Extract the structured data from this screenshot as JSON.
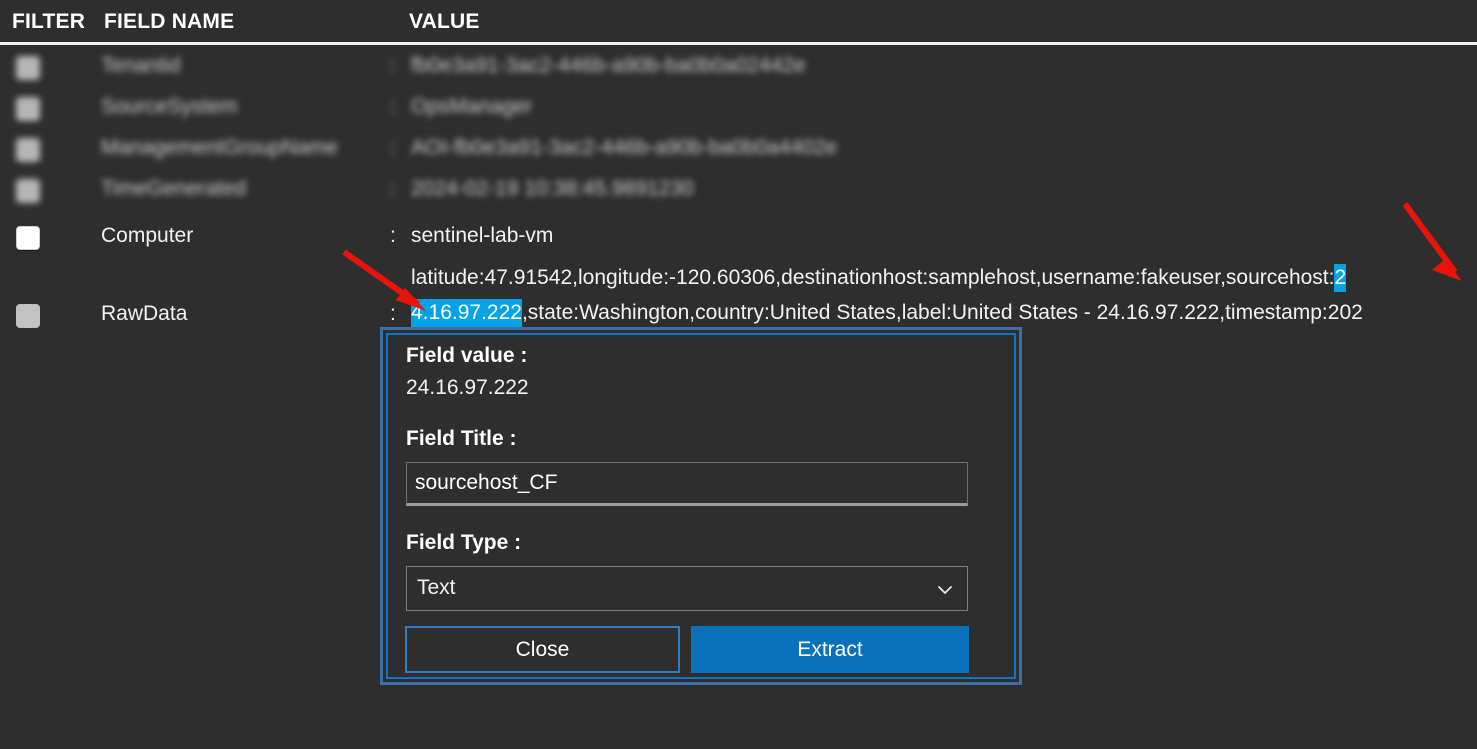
{
  "header": {
    "filter": "FILTER",
    "field_name": "FIELD NAME",
    "value": "VALUE"
  },
  "colors": {
    "background": "#2e2e2e",
    "accent_blue": "#0a72bd",
    "highlight_cyan": "#04a3e8",
    "dialog_border_outer": "#3d6fa5",
    "dialog_border_inner": "#1275c4",
    "arrow_red": "#e8140a",
    "text": "#f2f2f2"
  },
  "rows": [
    {
      "name": "Tenantid",
      "colon": ":",
      "value": "fb0e3a91-3ac2-446b-a90b-ba0b0a02442e",
      "checkbox": "blurred",
      "redacted": true
    },
    {
      "name": "SourceSystem",
      "colon": ":",
      "value": "OpsManager",
      "checkbox": "blurred",
      "redacted": true
    },
    {
      "name": "ManagementGroupName",
      "colon": ":",
      "value": "AOI-fb0e3a91-3ac2-446b-a90b-ba0b0a4402e",
      "checkbox": "blurred",
      "redacted": true
    },
    {
      "name": "TimeGenerated",
      "colon": ":",
      "value": "2024-02-19 10:38:45.9891230",
      "checkbox": "blurred",
      "redacted": true
    },
    {
      "name": "Computer",
      "colon": ":",
      "value": "sentinel-lab-vm",
      "checkbox": "white",
      "redacted": false
    },
    {
      "name": "RawData",
      "colon": ":",
      "value": "",
      "checkbox": "gray",
      "redacted": false
    }
  ],
  "rawdata": {
    "line1_prefix": "latitude:47.91542,longitude:-120.60306,destinationhost:samplehost,username:fakeuser,sourcehost:",
    "line1_highlight": "2",
    "line2_highlight": "4.16.97.222",
    "line2_suffix": ",state:Washington,country:United States,label:United States - 24.16.97.222,timestamp:202"
  },
  "dialog": {
    "field_value_label": "Field value :",
    "field_value": "24.16.97.222",
    "field_title_label": "Field Title :",
    "field_title_value": "sourcehost_CF",
    "field_title_placeholder": "",
    "field_type_label": "Field Type :",
    "field_type_selected": "Text",
    "field_type_options": [
      "Text"
    ],
    "close_button": "Close",
    "extract_button": "Extract",
    "chevron_icon": "chevron-down-icon"
  },
  "annotations": {
    "arrow_left": "red-arrow-pointing-to-highlighted-ip",
    "arrow_right": "red-arrow-pointing-to-highlighted-sourcehost-value"
  }
}
